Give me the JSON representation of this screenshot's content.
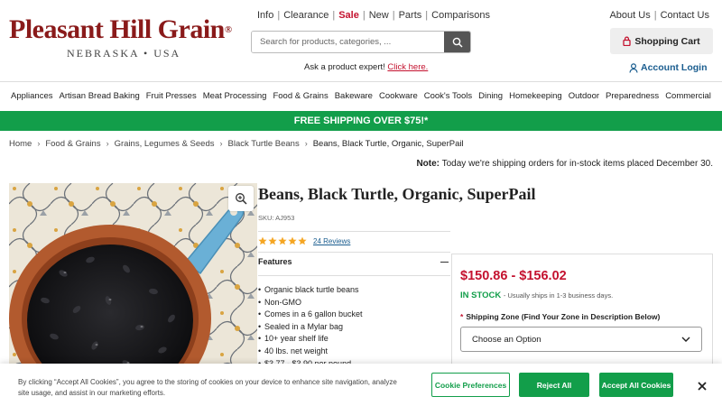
{
  "header": {
    "logo_main": "Pleasant Hill Grain",
    "logo_reg": "®",
    "logo_sub": "NEBRASKA • USA",
    "top_links": [
      "Info",
      "Clearance",
      "Sale",
      "New",
      "Parts",
      "Comparisons"
    ],
    "right_links": [
      "About Us",
      "Contact Us"
    ],
    "search_placeholder": "Search for products, categories, ...",
    "expert_text": "Ask a product expert!",
    "expert_link": "Click here.",
    "cart_label": "Shopping Cart",
    "login_label": "Account Login"
  },
  "nav": {
    "items": [
      "Appliances",
      "Artisan Bread Baking",
      "Fruit Presses",
      "Meat Processing",
      "Food & Grains",
      "Bakeware",
      "Cookware",
      "Cook's Tools",
      "Dining",
      "Homekeeping",
      "Outdoor",
      "Preparedness",
      "Commercial"
    ]
  },
  "banner": {
    "text": "FREE SHIPPING OVER $75!*"
  },
  "breadcrumb": [
    "Home",
    "Food & Grains",
    "Grains, Legumes & Seeds",
    "Black Turtle Beans",
    "Beans, Black Turtle, Organic, SuperPail"
  ],
  "note": {
    "label": "Note:",
    "text": "Today we're shipping orders for in-stock items placed December 30."
  },
  "product": {
    "title": "Beans, Black Turtle, Organic, SuperPail",
    "sku": "SKU: AJ953",
    "rating": 5,
    "reviews": "24 Reviews",
    "features_heading": "Features",
    "features_toggle": "—",
    "features": [
      "Organic black turtle beans",
      "Non-GMO",
      "Comes in a 6 gallon bucket",
      "Sealed in a Mylar bag",
      "10+ year shelf life",
      "40 lbs. net weight",
      "$3.77 - $3.90 per pound"
    ]
  },
  "buybox": {
    "price": "$150.86 - $156.02",
    "stock": "IN STOCK",
    "ship_note": "- Usually ships in 1-3 business days.",
    "zone_required": "*",
    "zone_label": "Shipping Zone (Find Your Zone in Description Below)",
    "zone_selected": "Choose an Option"
  },
  "cookie": {
    "text": "By clicking “Accept All Cookies”, you agree to the storing of cookies on your device to enhance site navigation, analyze site usage, and assist in our marketing efforts.",
    "pref_btn": "Cookie Preferences",
    "reject_btn": "Reject All",
    "accept_btn": "Accept All Cookies"
  },
  "colors": {
    "brand_red": "#8a1a1a",
    "sale_red": "#c4122f",
    "green": "#129e4a",
    "link_blue": "#1a5d8f",
    "star": "#f5a623"
  },
  "icons": [
    "search-icon",
    "lock-icon",
    "user-icon",
    "zoom-icon",
    "chevron-down-icon",
    "close-icon",
    "star-icon"
  ]
}
